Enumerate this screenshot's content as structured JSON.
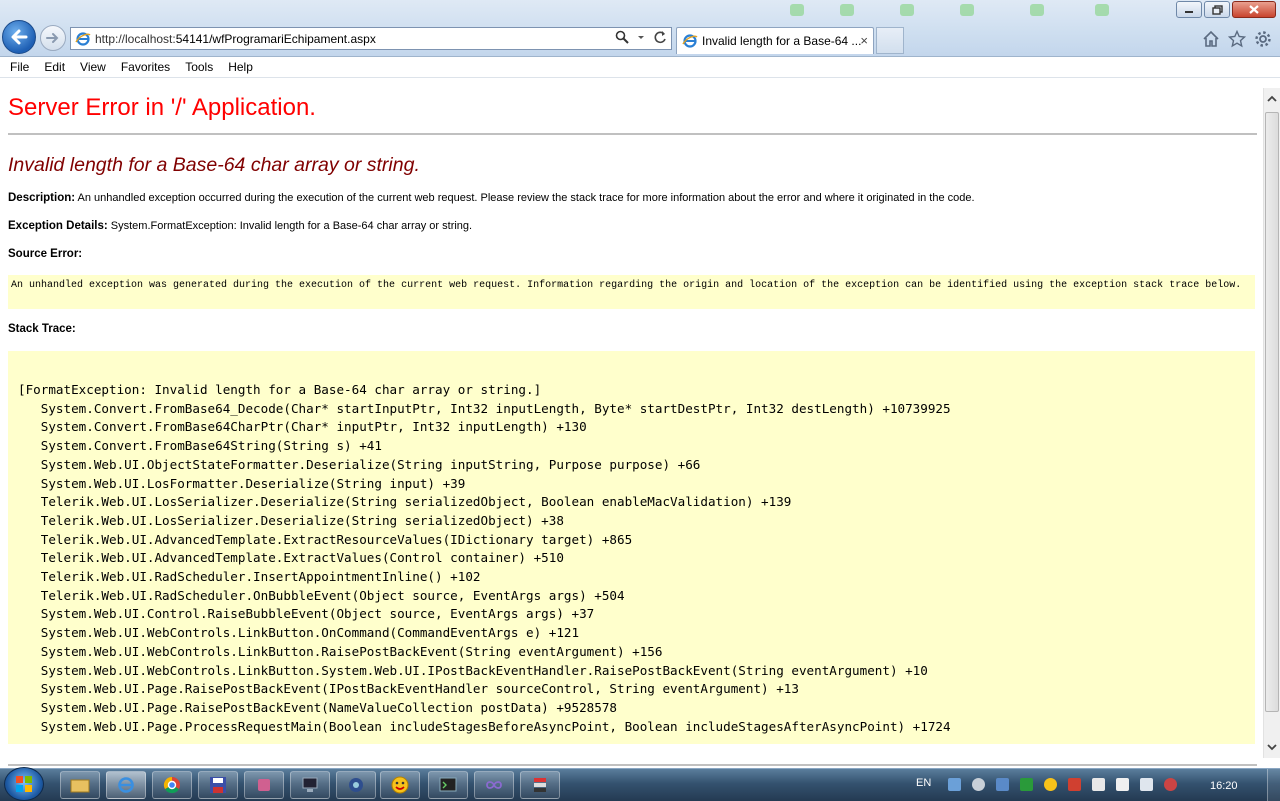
{
  "browser": {
    "url_host": "http://localhost:",
    "url_rest": "54141/wfProgramariEchipament.aspx",
    "tab_title": "Invalid length for a Base-64 ...",
    "tab_close": "×"
  },
  "menubar": {
    "items": [
      {
        "label": "File"
      },
      {
        "label": "Edit"
      },
      {
        "label": "View"
      },
      {
        "label": "Favorites"
      },
      {
        "label": "Tools"
      },
      {
        "label": "Help"
      }
    ]
  },
  "page": {
    "heading": "Server Error in '/' Application.",
    "exception_title": "Invalid length for a Base-64 char array or string.",
    "description_label": "Description:",
    "description_text": "An unhandled exception occurred during the execution of the current web request. Please review the stack trace for more information about the error and where it originated in the code.",
    "exception_details_label": "Exception Details:",
    "exception_details_text": "System.FormatException: Invalid length for a Base-64 char array or string.",
    "source_error_label": "Source Error:",
    "source_error_text": "An unhandled exception was generated during the execution of the current web request. Information regarding the origin and location of the exception can be identified using the exception stack trace below.",
    "stack_trace_label": "Stack Trace:",
    "stack_lines": [
      "[FormatException: Invalid length for a Base-64 char array or string.]",
      "   System.Convert.FromBase64_Decode(Char* startInputPtr, Int32 inputLength, Byte* startDestPtr, Int32 destLength) +10739925",
      "   System.Convert.FromBase64CharPtr(Char* inputPtr, Int32 inputLength) +130",
      "   System.Convert.FromBase64String(String s) +41",
      "   System.Web.UI.ObjectStateFormatter.Deserialize(String inputString, Purpose purpose) +66",
      "   System.Web.UI.LosFormatter.Deserialize(String input) +39",
      "   Telerik.Web.UI.LosSerializer.Deserialize(String serializedObject, Boolean enableMacValidation) +139",
      "   Telerik.Web.UI.LosSerializer.Deserialize(String serializedObject) +38",
      "   Telerik.Web.UI.AdvancedTemplate.ExtractResourceValues(IDictionary target) +865",
      "   Telerik.Web.UI.AdvancedTemplate.ExtractValues(Control container) +510",
      "   Telerik.Web.UI.RadScheduler.InsertAppointmentInline() +102",
      "   Telerik.Web.UI.RadScheduler.OnBubbleEvent(Object source, EventArgs args) +504",
      "   System.Web.UI.Control.RaiseBubbleEvent(Object source, EventArgs args) +37",
      "   System.Web.UI.WebControls.LinkButton.OnCommand(CommandEventArgs e) +121",
      "   System.Web.UI.WebControls.LinkButton.RaisePostBackEvent(String eventArgument) +156",
      "   System.Web.UI.WebControls.LinkButton.System.Web.UI.IPostBackEventHandler.RaisePostBackEvent(String eventArgument) +10",
      "   System.Web.UI.Page.RaisePostBackEvent(IPostBackEventHandler sourceControl, String eventArgument) +13",
      "   System.Web.UI.Page.RaisePostBackEvent(NameValueCollection postData) +9528578",
      "   System.Web.UI.Page.ProcessRequestMain(Boolean includeStagesBeforeAsyncPoint, Boolean includeStagesAfterAsyncPoint) +1724"
    ]
  },
  "taskbar": {
    "language": "EN",
    "clock": "16:20"
  },
  "colors": {
    "heading": "#ff0000",
    "exception_title": "#800000",
    "code_background": "#ffffcc"
  },
  "icons": [
    "back-icon",
    "forward-icon",
    "ie-page-icon",
    "search-icon",
    "dropdown-icon",
    "refresh-icon",
    "home-icon",
    "favorites-star-icon",
    "tools-gear-icon",
    "windows-start-icon"
  ]
}
